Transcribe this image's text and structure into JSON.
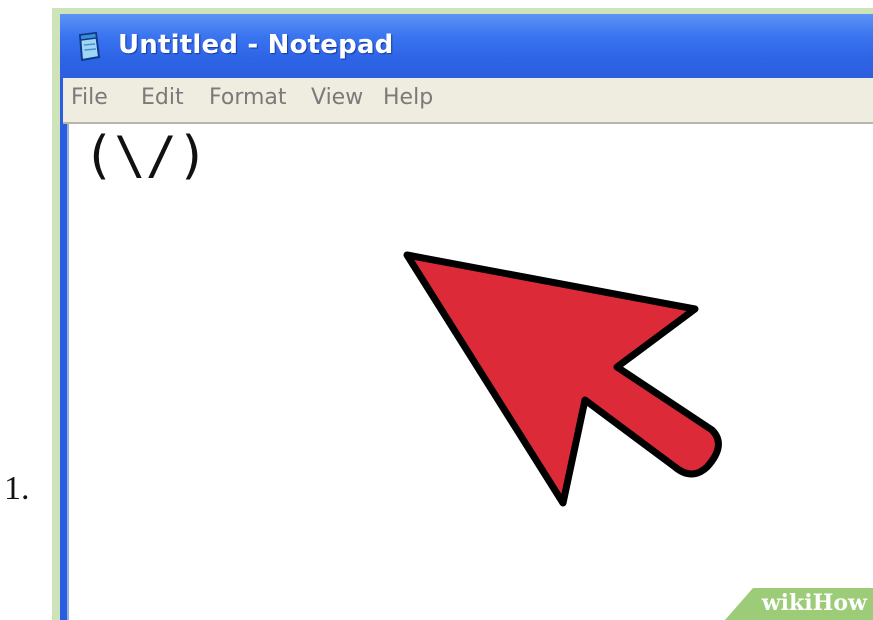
{
  "step": {
    "number": "1."
  },
  "window": {
    "title": "Untitled - Notepad",
    "icon": "notepad-icon"
  },
  "menu": {
    "items": [
      {
        "label": "File"
      },
      {
        "label": "Edit"
      },
      {
        "label": "Format"
      },
      {
        "label": "View"
      },
      {
        "label": "Help"
      }
    ]
  },
  "editor": {
    "content": "(\\/)"
  },
  "overlay": {
    "arrow_icon": "red-pointer-arrow-icon",
    "arrow_color": "#dc2a38"
  },
  "watermark": {
    "part1": "wiki",
    "part2": "How"
  },
  "colors": {
    "titlebar": "#2d64e6",
    "menubar": "#efece0",
    "frame_green": "#cfe3b8",
    "watermark_green": "#9ccc78"
  }
}
